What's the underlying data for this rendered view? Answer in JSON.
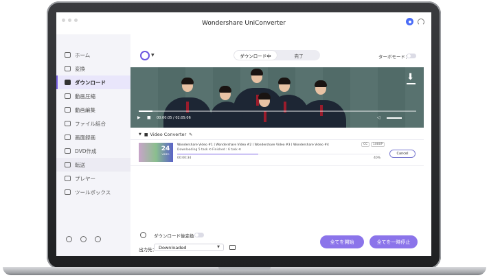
{
  "app": {
    "title": "Wondershare UniConverter"
  },
  "sidebar": {
    "items": [
      {
        "label": "ホーム",
        "icon": "home-icon"
      },
      {
        "label": "変換",
        "icon": "convert-icon"
      },
      {
        "label": "ダウンロード",
        "icon": "download-icon",
        "active": true
      },
      {
        "label": "動画圧縮",
        "icon": "compress-icon"
      },
      {
        "label": "動画編集",
        "icon": "edit-icon"
      },
      {
        "label": "ファイル結合",
        "icon": "merge-icon"
      },
      {
        "label": "画面録画",
        "icon": "record-icon"
      },
      {
        "label": "DVD作成",
        "icon": "dvd-icon"
      },
      {
        "label": "転送",
        "icon": "transfer-icon"
      },
      {
        "label": "プレヤー",
        "icon": "player-icon"
      },
      {
        "label": "ツールボックス",
        "icon": "toolbox-icon"
      }
    ]
  },
  "toolbar": {
    "tabs": [
      "ダウンロード中",
      "完了"
    ],
    "turbo_label": "ターボモード："
  },
  "player": {
    "time": "00:00:05 / 02:05:06"
  },
  "group": {
    "label": "Video Converter"
  },
  "item": {
    "thumb_count": "24",
    "thumb_label": "VIDEO",
    "title": "Wondershare Video #1丨Wondershare Video #2丨Wondershare Video #3丨Wondershare Video #4",
    "badge_cc": "CC",
    "badge_res": "1080P",
    "status": "Downloading 5 task  ⟲  Finished : 6 task  ⟲",
    "time": "00:00:34",
    "percent": "40%",
    "progress": 0.4,
    "cancel_label": "Cancel"
  },
  "bottom": {
    "after_label": "ダウンロード後変換",
    "output_label": "出力先：",
    "output_value": "Downloaded",
    "start_all": "全てを開始",
    "pause_all": "全てを一時停止"
  },
  "colors": {
    "accent": "#7a63e5",
    "button": "#8b74ea"
  }
}
